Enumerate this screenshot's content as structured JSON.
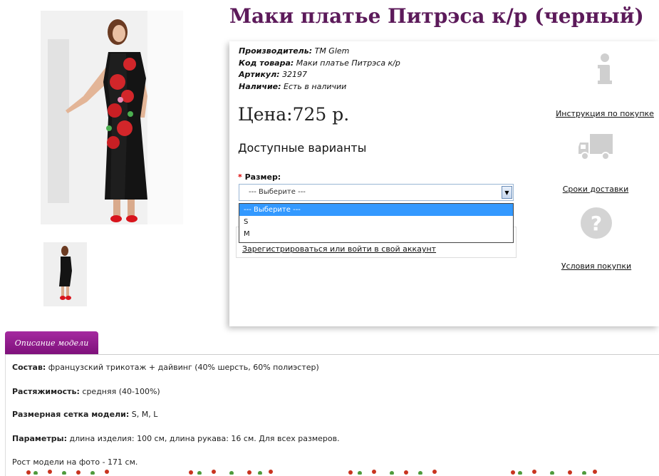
{
  "product": {
    "title": "Маки платье Питрэса к/р (черный)",
    "manufacturer_label": "Производитель:",
    "manufacturer": "ТМ Glem",
    "code_label": "Код товара:",
    "code": "Маки платье Питрэса к/р",
    "sku_label": "Артикул:",
    "sku": "32197",
    "availability_label": "Наличие:",
    "availability": "Есть в наличии",
    "price": "Цена:725 р.",
    "variants_heading": "Доступные варианты"
  },
  "size": {
    "label": "Размер:",
    "required_mark": "*",
    "selected": "--- Выберите ---",
    "options": [
      "--- Выберите ---",
      "S",
      "M"
    ]
  },
  "account_link": "Зарегистрироваться или войти в свой аккаунт",
  "side_links": {
    "instructions": "Инструкция по покупке",
    "delivery": "Сроки доставки",
    "terms": "Условия покупки"
  },
  "tab": {
    "label": "Описание модели"
  },
  "description": [
    {
      "label": "Состав:",
      "text": " французский трикотаж + дайвинг  (40% шерсть, 60% полиэстер)"
    },
    {
      "label": "Растяжимость:",
      "text": " средняя (40-100%)"
    },
    {
      "label": "Размерная сетка модели:",
      "text": " S, M, L"
    },
    {
      "label": "Параметры:",
      "text": " длина изделия: 100 см, длина рукава: 16 см. Для всех размеров."
    },
    {
      "label": "",
      "text": "Рост модели на фото - 171 см."
    }
  ],
  "icons": {
    "info": "info-icon",
    "truck": "truck-icon",
    "question": "question-icon"
  },
  "colors": {
    "title": "#5c1a5a",
    "tab": "#8e1a8b",
    "select_highlight": "#3399ff"
  }
}
